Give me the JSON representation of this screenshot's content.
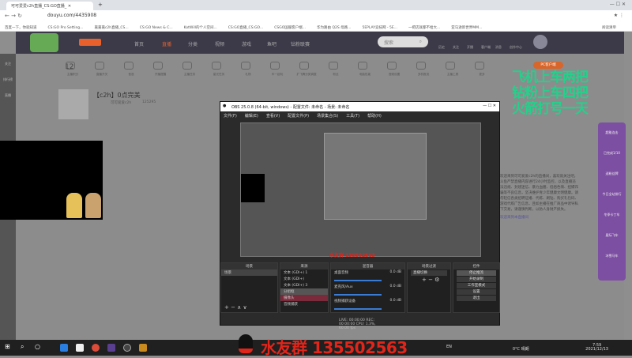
{
  "browser": {
    "tab_title": "可可爱爱c2h直播_CS:GO直播_",
    "url": "douyu.com/4435908",
    "bookmarks": [
      "百度一下，你就知道",
      "CS:GO Pro Setting...",
      "嘉嘉嘉c2h直播_CS...",
      "CS:GO News & C...",
      "KotWill的个人空间...",
      "CS:GO直播_CS:GO...",
      "CSGO国服客户端...",
      "华为路由 Q2S 母路...",
      "5EPLAY竞技网 - 5E...",
      "一把店就都不给大...",
      "亚马逊新世界MM..."
    ],
    "reading_list": "阅读清单"
  },
  "nav": {
    "items": [
      "首页",
      "直播",
      "分类",
      "视频",
      "游戏",
      "鱼吧",
      "钻粉联赛"
    ],
    "search_placeholder": "搜索",
    "user_items": [
      "历史",
      "关注",
      "开播",
      "客户端",
      "消息",
      "创作中心"
    ]
  },
  "sidebar": [
    "关注",
    "排行榜",
    "直播"
  ],
  "tools": {
    "count": "12",
    "labels": [
      "主播积分",
      "直播开关",
      "音浪",
      "开播提醒",
      "主播任务",
      "星光任务",
      "礼物",
      "车一起玩",
      "扩飞腾分类调整",
      "粉丝",
      "电脑性能",
      "音频设置",
      "多机推流",
      "主播工具",
      "更多"
    ],
    "pc_client": "PC客户端"
  },
  "room": {
    "title": "【c2h】0点完美",
    "fans": "可可爱爱c2h",
    "hot": "125295",
    "follow": "关注"
  },
  "obs": {
    "title": "OBS 25.0.8 (64-bit, windows) - 配置文件: 未命名 - 场景: 未命名",
    "menu": [
      "文件(F)",
      "编辑(E)",
      "查看(V)",
      "配置文件(P)",
      "场景集合(S)",
      "工具(T)",
      "帮助(H)"
    ],
    "docks": {
      "scenes": "场景",
      "sources": "来源",
      "mixer": "混音器",
      "transitions": "场景过渡",
      "controls": "控件"
    },
    "scene_items": [
      "场景"
    ],
    "source_items": [
      "文本 (GDI+) 1",
      "文本 (GDI+)",
      "文本 (GDI+) 3",
      "分组框",
      "摄像头",
      "音频捕获"
    ],
    "mixer_items": [
      {
        "name": "桌面音频",
        "db": "0.0 dB"
      },
      {
        "name": "麦克风/Aux",
        "db": "0.0 dB"
      },
      {
        "name": "视频捕获设备",
        "db": "0.0 dB"
      }
    ],
    "transition": "直播切换",
    "controls": [
      "停止推流",
      "开始录制",
      "工作室模式",
      "设置",
      "退出"
    ],
    "status": "LIVE: 00:00:00   REC: 00:00:00   CPU: 1.3%, 60.00 fps"
  },
  "overlay": {
    "lines": [
      "飞机上车两把",
      "钻粉上车四把",
      "火箭打号一天"
    ],
    "qq_group": "水友群 135502563"
  },
  "chat": [
    "欢迎来到可可爱爱c2h的直播间，喜欢就关注吧。斗鱼严禁直播内容进行24小时监控，以及直播违法违规、封建迷信、暴力血腥、低俗色情、招嫖诈骗等不良信息，坚决维护青少年健康文明健康。请勿轻信各类招聘征婚、代练、刷钻、购买礼包码、游戏代练广告信息，且如主播在推广商品中诱导私下交易，请谨慎判断，以防人身财产损失。",
    "欢迎来到本直播间"
  ],
  "side_panel": [
    "超能连击",
    "已完成1/10",
    "送粉丝牌",
    "今日全站排行",
    "冬季卡丁车",
    "星际飞车",
    "冰雪马车"
  ],
  "taskbar": {
    "weather": "0°C 晴朗",
    "time": "7:59",
    "date": "2021/12/13",
    "lang": "EN"
  }
}
